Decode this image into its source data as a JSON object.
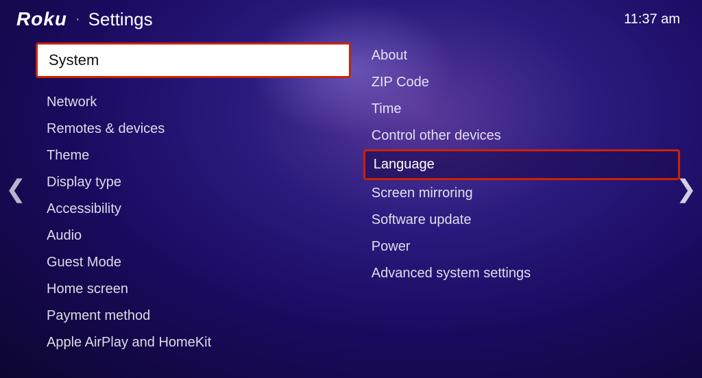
{
  "header": {
    "logo": "Roku",
    "dot": "·",
    "title": "Settings",
    "time": "11:37 am"
  },
  "nav": {
    "left_arrow": "❮",
    "right_arrow": "❯"
  },
  "left_panel": {
    "selected_item": "System",
    "menu_items": [
      {
        "label": "Network"
      },
      {
        "label": "Remotes & devices"
      },
      {
        "label": "Theme"
      },
      {
        "label": "Display type"
      },
      {
        "label": "Accessibility"
      },
      {
        "label": "Audio"
      },
      {
        "label": "Guest Mode"
      },
      {
        "label": "Home screen"
      },
      {
        "label": "Payment method"
      },
      {
        "label": "Apple AirPlay and HomeKit"
      }
    ]
  },
  "right_panel": {
    "menu_items": [
      {
        "label": "About",
        "selected": false
      },
      {
        "label": "ZIP Code",
        "selected": false
      },
      {
        "label": "Time",
        "selected": false
      },
      {
        "label": "Control other devices",
        "selected": false
      },
      {
        "label": "Language",
        "selected": true
      },
      {
        "label": "Screen mirroring",
        "selected": false
      },
      {
        "label": "Software update",
        "selected": false
      },
      {
        "label": "Power",
        "selected": false
      },
      {
        "label": "Advanced system settings",
        "selected": false
      }
    ]
  }
}
